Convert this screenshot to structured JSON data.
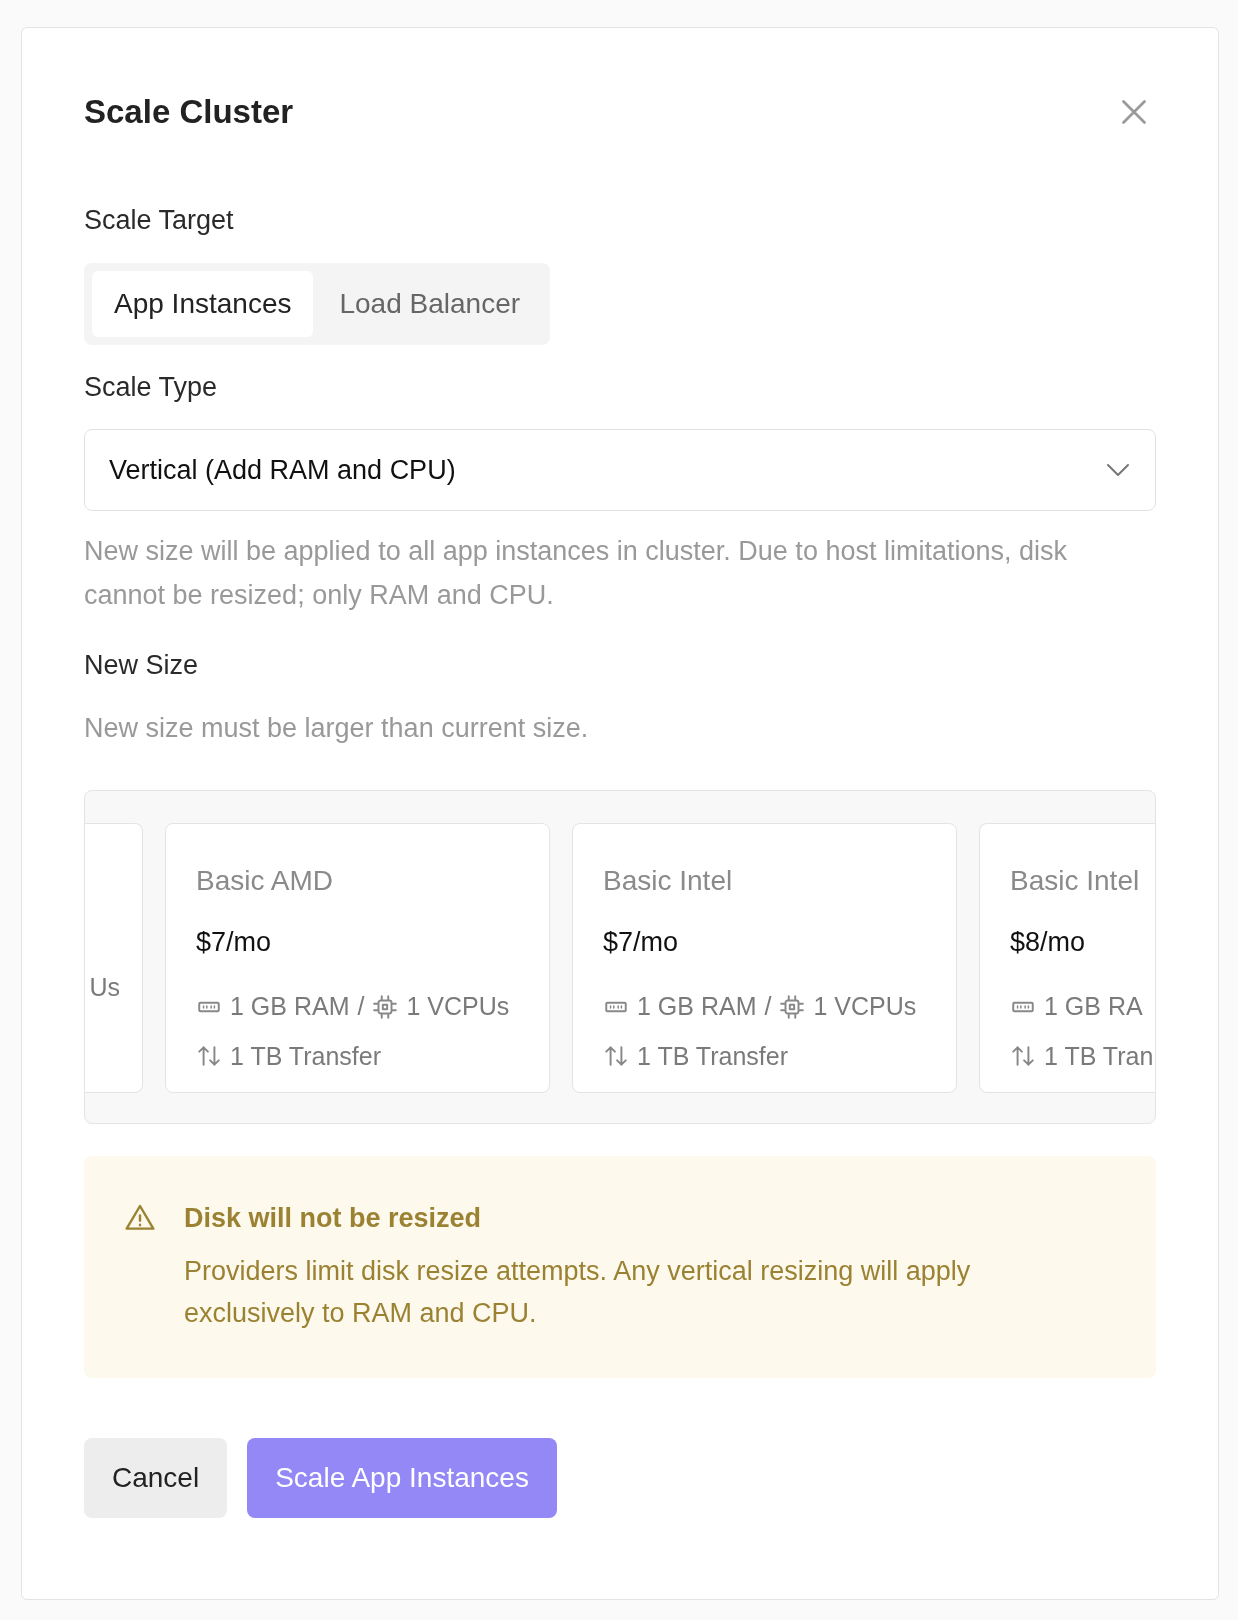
{
  "dialog": {
    "title": "Scale Cluster",
    "scale_target": {
      "label": "Scale Target",
      "tabs": [
        {
          "label": "App Instances",
          "selected": true
        },
        {
          "label": "Load Balancer",
          "selected": false
        }
      ]
    },
    "scale_type": {
      "label": "Scale Type",
      "value": "Vertical (Add RAM and CPU)",
      "help": "New size will be applied to all app instances in cluster. Due to host limitations, disk cannot be resized; only RAM and CPU."
    },
    "new_size": {
      "label": "New Size",
      "help": "New size must be larger than current size.",
      "plans": [
        {
          "kind": "cut-left",
          "cpu": "Us"
        },
        {
          "kind": "full",
          "tier": "Basic AMD",
          "price": "$7/mo",
          "ram": "1 GB RAM",
          "separator": "/",
          "cpu": "1 VCPUs",
          "transfer": "1 TB Transfer"
        },
        {
          "kind": "full",
          "tier": "Basic Intel",
          "price": "$7/mo",
          "ram": "1 GB RAM",
          "separator": "/",
          "cpu": "1 VCPUs",
          "transfer": "1 TB Transfer"
        },
        {
          "kind": "cut-right",
          "tier": "Basic Intel",
          "price": "$8/mo",
          "ram": "1 GB RA",
          "transfer": "1 TB Tran"
        }
      ]
    },
    "alert": {
      "title": "Disk will not be resized",
      "text": "Providers limit disk resize attempts. Any vertical resizing will apply exclusively to RAM and CPU."
    },
    "buttons": [
      {
        "kind": "secondary",
        "label": "Cancel"
      },
      {
        "kind": "primary",
        "label": "Scale App Instances"
      }
    ]
  }
}
